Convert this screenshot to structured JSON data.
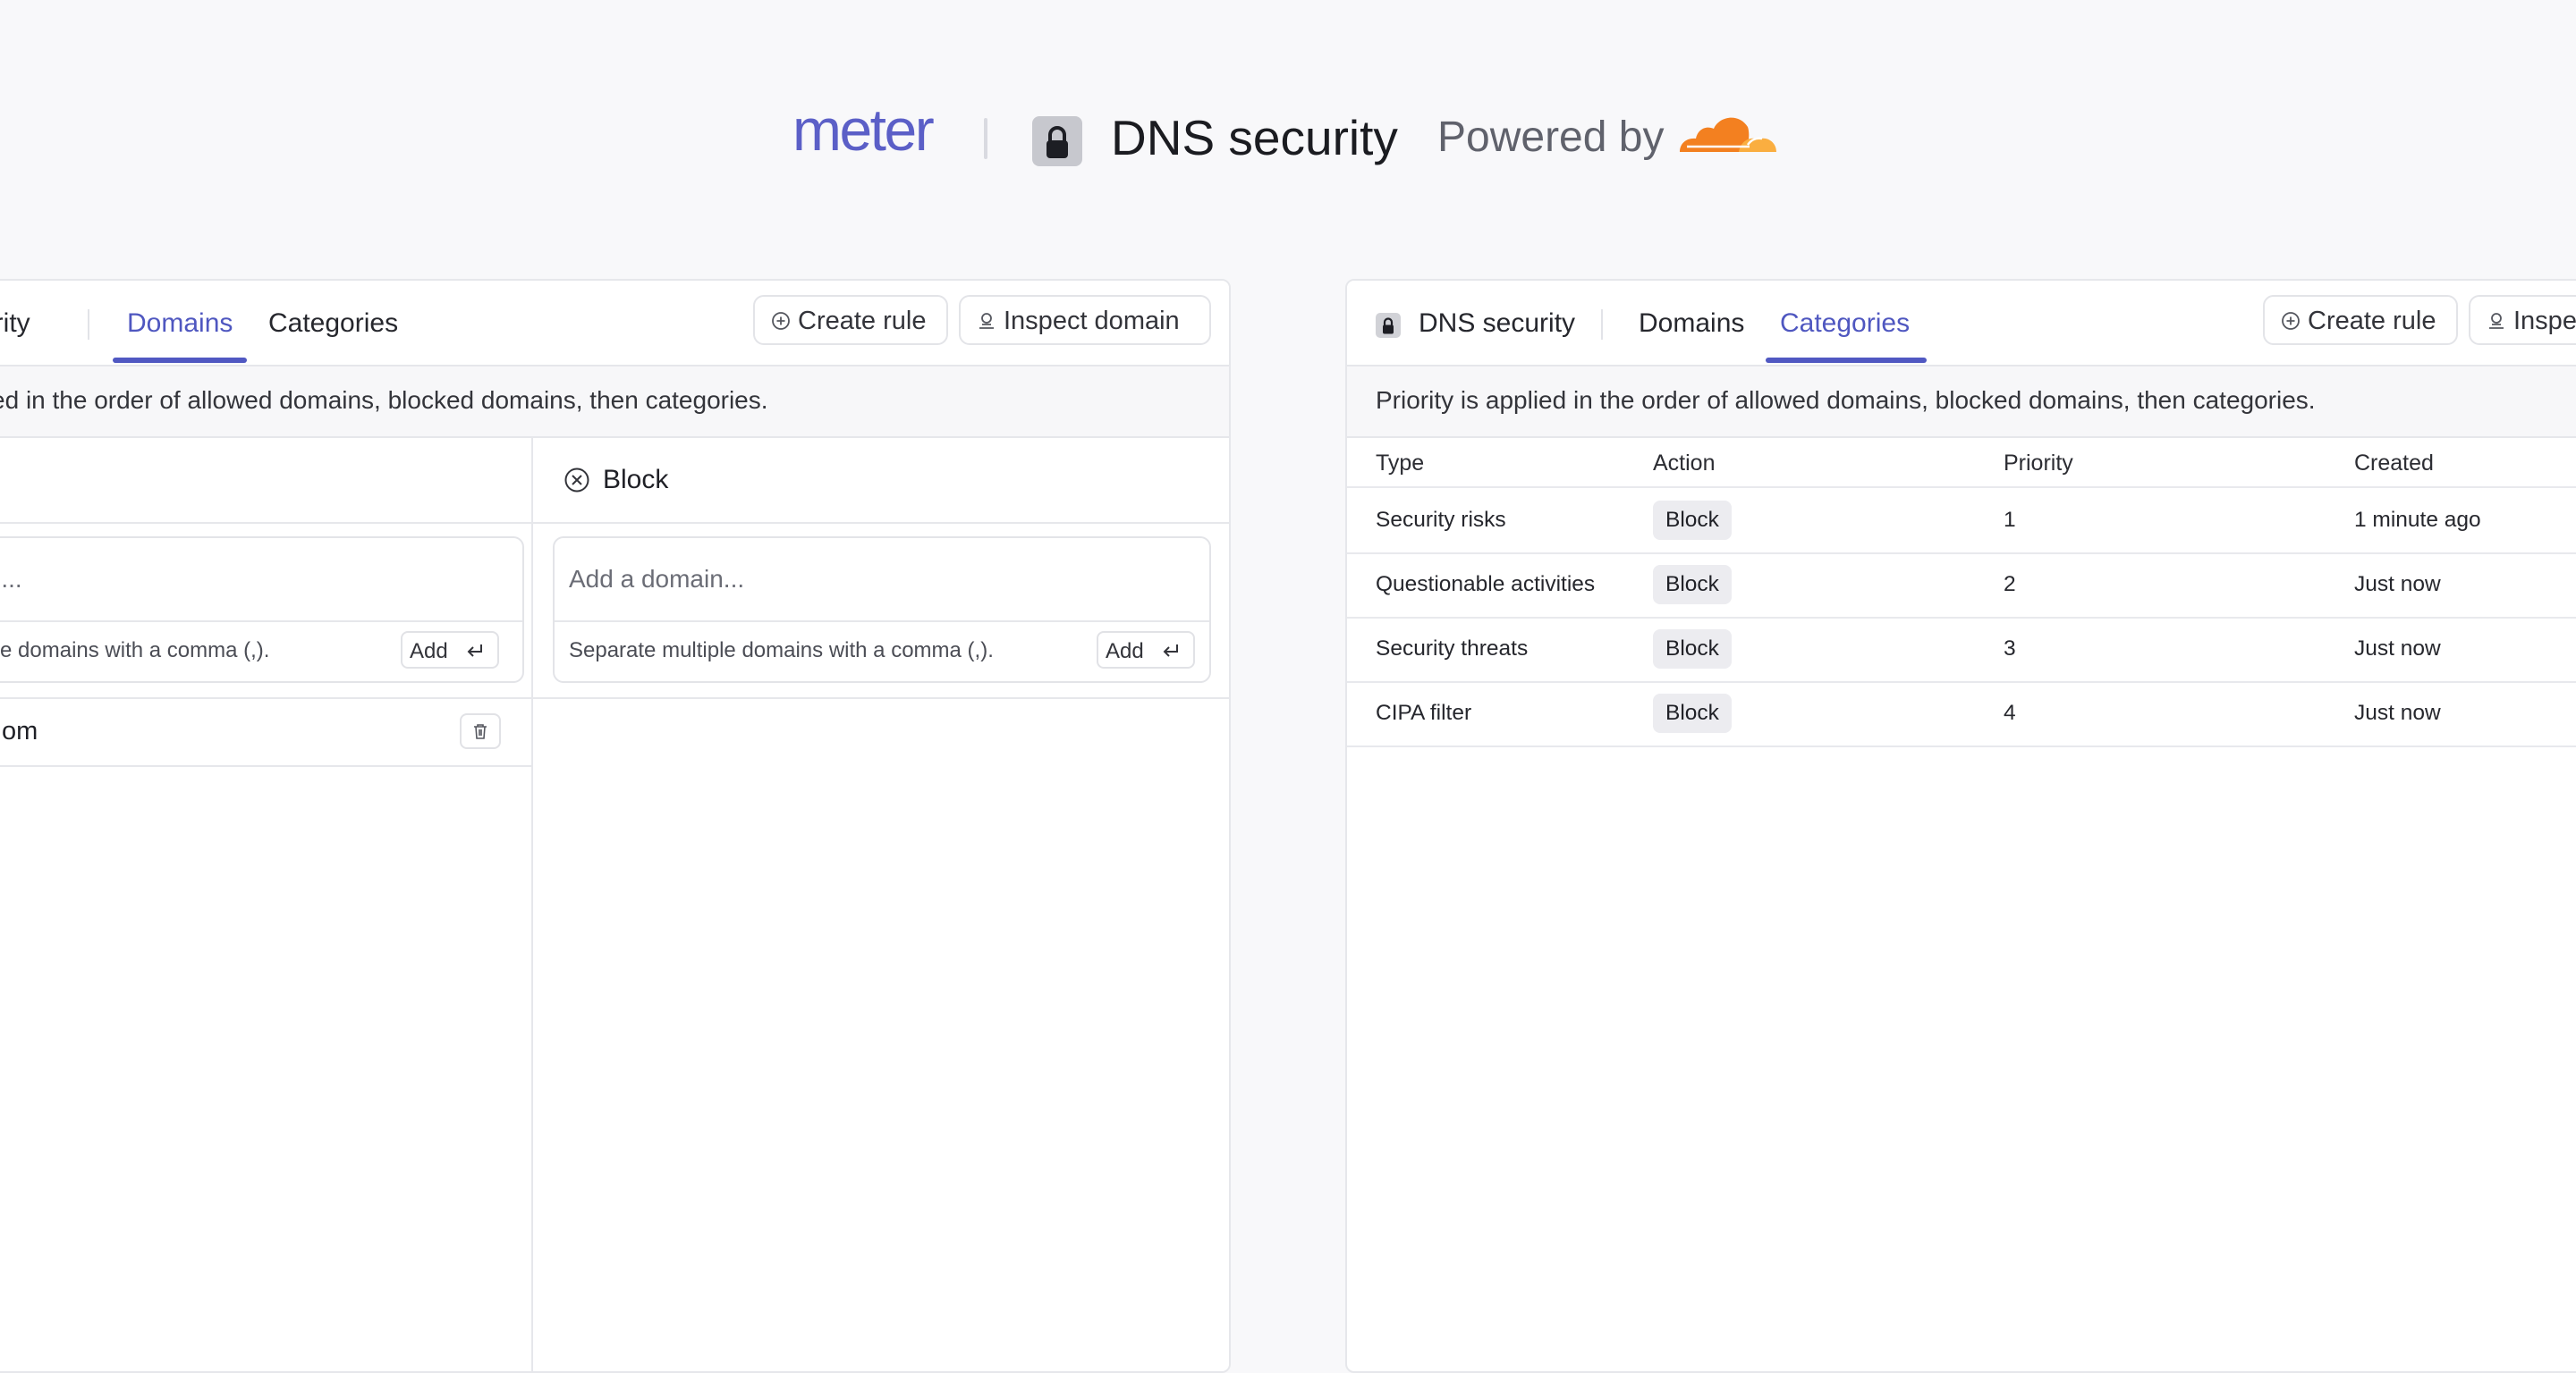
{
  "header": {
    "logo_text": "meter",
    "title": "DNS security",
    "powered_by": "Powered by",
    "partner_logo": "cloudflare-logo",
    "colors": {
      "brand": "#5b5fc7",
      "cloud_orange": "#f38020",
      "cloud_light": "#faae40"
    }
  },
  "left_panel": {
    "title_partial": "curity",
    "tabs": [
      {
        "label": "Domains",
        "active": true
      },
      {
        "label": "Categories",
        "active": false
      }
    ],
    "actions": {
      "create_rule": "Create rule",
      "inspect_domain": "Inspect domain"
    },
    "notice": "plied in the order of allowed domains, blocked domains, then categories.",
    "allow_column": {
      "input_placeholder": "ain...",
      "hint": "ltiple domains with a comma (,).",
      "add_label": "Add",
      "domains": [
        "om"
      ]
    },
    "block_column": {
      "title": "Block",
      "input_placeholder": "Add a domain...",
      "hint": "Separate multiple domains with a comma (,).",
      "add_label": "Add"
    }
  },
  "right_panel": {
    "title": "DNS security",
    "tabs": [
      {
        "label": "Domains",
        "active": false
      },
      {
        "label": "Categories",
        "active": true
      }
    ],
    "actions": {
      "create_rule": "Create rule",
      "inspect_partial": "Inspe"
    },
    "notice": "Priority is applied in the order of allowed domains, blocked domains, then categories.",
    "table": {
      "columns": [
        "Type",
        "Action",
        "Priority",
        "Created"
      ],
      "rows": [
        {
          "type": "Security risks",
          "action": "Block",
          "priority": "1",
          "created": "1 minute ago"
        },
        {
          "type": "Questionable activities",
          "action": "Block",
          "priority": "2",
          "created": "Just now"
        },
        {
          "type": "Security threats",
          "action": "Block",
          "priority": "3",
          "created": "Just now"
        },
        {
          "type": "CIPA filter",
          "action": "Block",
          "priority": "4",
          "created": "Just now"
        }
      ]
    }
  }
}
